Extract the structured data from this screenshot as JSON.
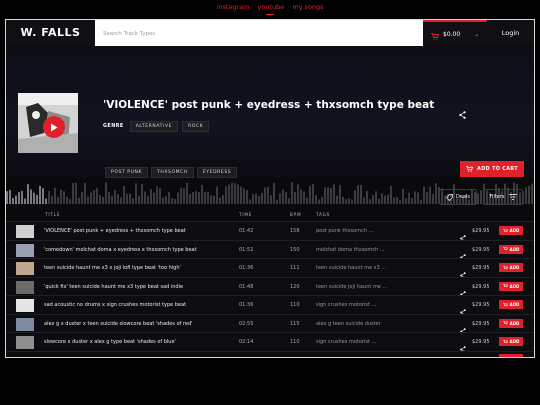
{
  "top_links": [
    "instagram",
    "youtube",
    "my songs"
  ],
  "header": {
    "logo": "W. FALLS",
    "search_placeholder": "Search Track Types",
    "cart_amount": "$0.00",
    "login": "Login"
  },
  "hero": {
    "title": "'VIOLENCE' post punk + eyedress + thxsomch type beat",
    "genre_label": "GENRE",
    "genres": [
      "ALTERNATIVE",
      "ROCK"
    ],
    "tags": [
      "POST PUNK",
      "THXSOMCH",
      "EYEDRESS"
    ],
    "add_to_cart": "ADD TO CART"
  },
  "filters": {
    "deals": "Deals",
    "filters": "Filters"
  },
  "table": {
    "headers": {
      "title": "TITLE",
      "time": "TIME",
      "bpm": "BPM",
      "tags": "TAGS"
    },
    "add_label": "ADD",
    "rows": [
      {
        "title": "'VIOLENCE' post punk + eyedress + thxsomch type beat",
        "time": "01:42",
        "bpm": "158",
        "tags": "post punk  thxsomch ...",
        "price": "$29.95"
      },
      {
        "title": "'comedown' molchat doma x eyedress x thxsomch type beat",
        "time": "01:52",
        "bpm": "150",
        "tags": "molchat doma  thxsomch ...",
        "price": "$29.95"
      },
      {
        "title": "teen suicide haunt me x3 x joji lofi type beat 'too high'",
        "time": "01:36",
        "bpm": "111",
        "tags": "teen suicide haunt me x3 ...",
        "price": "$29.95"
      },
      {
        "title": "'quick fix' teen suicide haunt me x3 type beat sad indie",
        "time": "01:48",
        "bpm": "120",
        "tags": "teen suicide  joji  haunt me ...",
        "price": "$29.95"
      },
      {
        "title": "sad acoustic no drums x sign crushes motorist type beat",
        "time": "01:36",
        "bpm": "110",
        "tags": "sign crushes motorist ...",
        "price": "$29.95"
      },
      {
        "title": "alex g x duster x teen suicide slowcore beat 'shades of red'",
        "time": "02:55",
        "bpm": "115",
        "tags": "alex g  teen suicide  duster",
        "price": "$29.95"
      },
      {
        "title": "slowcore x duster x alex g type beat 'shades of blue'",
        "time": "02:14",
        "bpm": "110",
        "tags": "sign crushes motorist ...",
        "price": "$29.95"
      }
    ]
  },
  "colors": {
    "accent": "#e0202a",
    "background": "#0a0a0d"
  },
  "icons": [
    "cart-icon",
    "chevron-down-icon",
    "play-icon",
    "share-icon",
    "tag-icon",
    "filter-icon"
  ]
}
